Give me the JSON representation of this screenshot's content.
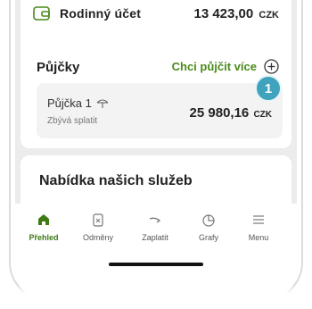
{
  "colors": {
    "accent": "#4a8a1a",
    "badge": "#3fa3bd",
    "active_tab": "#3f7a14"
  },
  "account": {
    "icon": "wallet-icon",
    "name": "Rodinný účet",
    "amount": "13 423,00",
    "currency": "CZK"
  },
  "loans": {
    "title": "Půjčky",
    "link_label": "Chci půjčit více",
    "link_icon": "plus-circle-icon",
    "item": {
      "name": "Půjčka 1",
      "icon": "umbrella-icon",
      "subtitle": "Zbývá splatit",
      "amount": "25 980,16",
      "currency": "CZK"
    }
  },
  "badge": {
    "number": "1"
  },
  "services": {
    "title": "Nabídka našich služeb"
  },
  "tabs": [
    {
      "label": "Přehled",
      "icon": "home-icon",
      "active": true
    },
    {
      "label": "Odměny",
      "icon": "rewards-icon",
      "active": false
    },
    {
      "label": "Zaplatit",
      "icon": "transfer-icon",
      "active": false
    },
    {
      "label": "Grafy",
      "icon": "chart-icon",
      "active": false
    },
    {
      "label": "Menu",
      "icon": "menu-icon",
      "active": false
    }
  ]
}
